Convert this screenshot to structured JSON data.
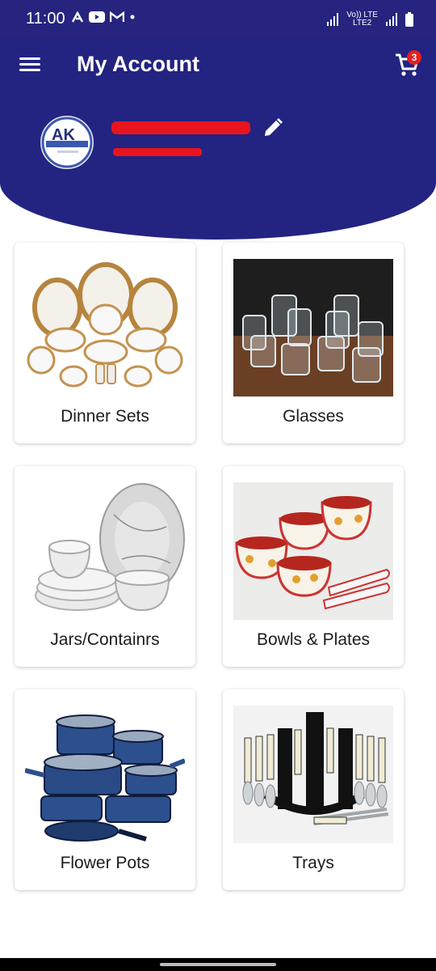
{
  "status_bar": {
    "time": "11:00",
    "network_top": "Vo)) LTE",
    "network_bottom": "LTE2"
  },
  "header": {
    "title": "My Account",
    "cart_count": "3",
    "avatar_text": "AK"
  },
  "categories": [
    {
      "label": "Dinner Sets"
    },
    {
      "label": "Glasses"
    },
    {
      "label": "Jars/Containrs"
    },
    {
      "label": "Bowls & Plates"
    },
    {
      "label": "Flower Pots"
    },
    {
      "label": "Trays"
    }
  ],
  "colors": {
    "header": "#232381",
    "badge": "#e02020",
    "redaction": "#e8141e"
  }
}
